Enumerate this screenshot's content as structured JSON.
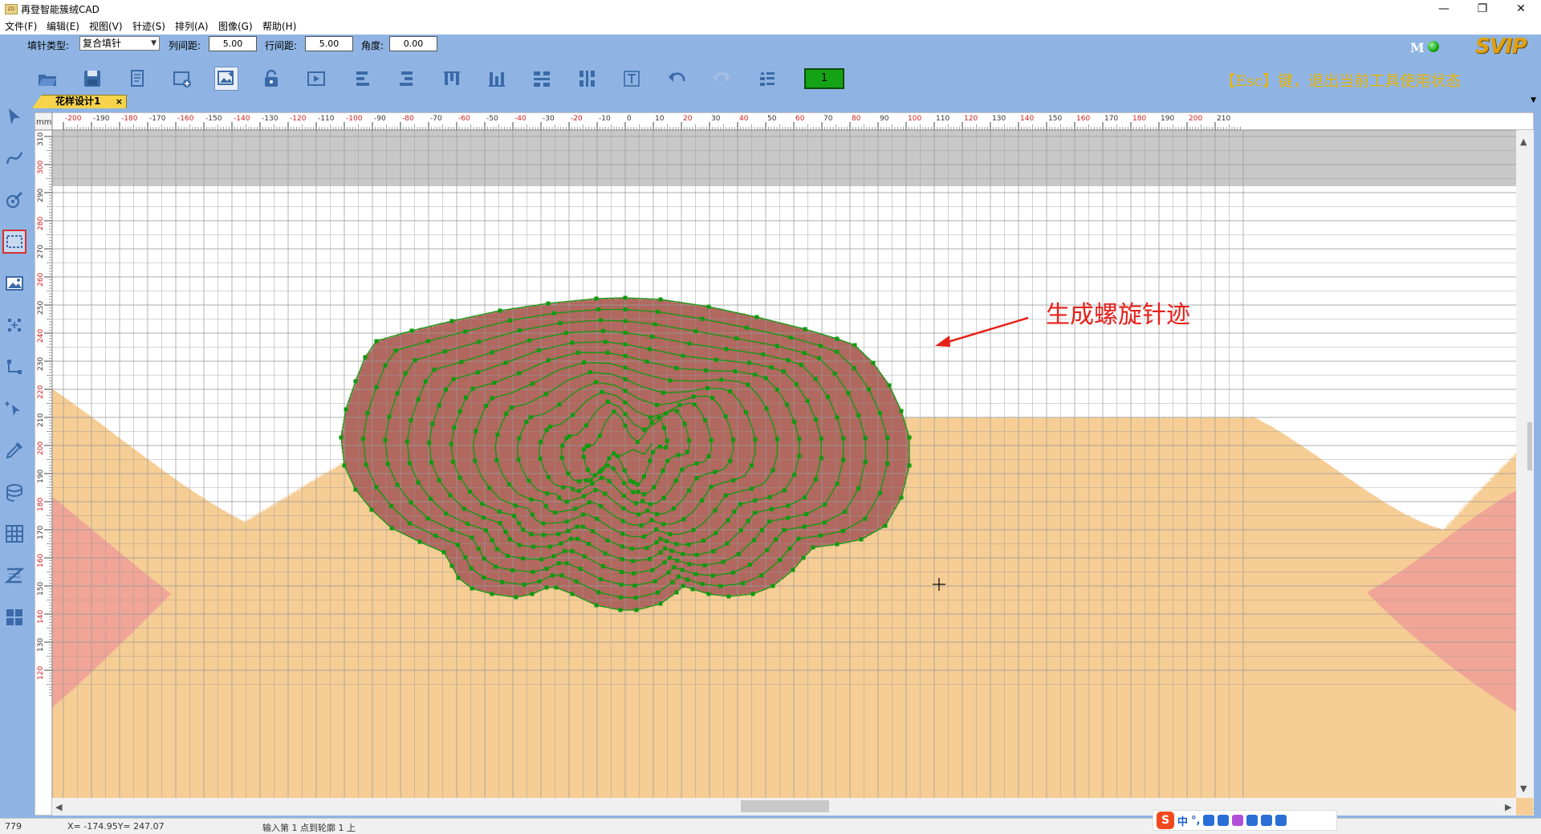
{
  "window": {
    "title": "再登智能簇绒CAD",
    "app_icon_text": "ZD",
    "minimize": "—",
    "restore": "❐",
    "close": "✕"
  },
  "menu": [
    {
      "label": "文件(F)"
    },
    {
      "label": "编辑(E)"
    },
    {
      "label": "视图(V)"
    },
    {
      "label": "针迹(S)"
    },
    {
      "label": "排列(A)"
    },
    {
      "label": "图像(G)"
    },
    {
      "label": "帮助(H)"
    }
  ],
  "params": {
    "fill_type_label": "填针类型:",
    "fill_type_value": "复合填针",
    "col_spacing_label": "列间距:",
    "col_spacing_value": "5.00",
    "row_spacing_label": "行间距:",
    "row_spacing_value": "5.00",
    "angle_label": "角度:",
    "angle_value": "0.00"
  },
  "status_indicators": {
    "m_badge": "M",
    "vip_badge": "SVIP"
  },
  "toolbar": {
    "counter_value": "1",
    "esc_hint": "【Esc】键，退出当前工具使用状态",
    "icons": [
      "open-folder-icon",
      "save-icon",
      "document-icon",
      "new-window-icon",
      "image-edit-icon",
      "unlock-icon",
      "play-icon",
      "align-left-icon",
      "align-right-icon",
      "align-top-icon",
      "align-bottom-icon",
      "distribute-h-icon",
      "distribute-v-icon",
      "text-icon",
      "undo-icon",
      "redo-icon",
      "list-order-icon"
    ]
  },
  "tabs": [
    {
      "label": "花样设计1",
      "close": "×"
    }
  ],
  "left_tools": [
    "select-arrow-icon",
    "curve-icon",
    "pen-tool-icon",
    "rect-select-icon",
    "image-icon",
    "node-edit-icon",
    "connect-icon",
    "cursor-plus-icon",
    "eyedropper-icon",
    "layer-icon",
    "grid-icon",
    "zigzag-icon",
    "tiles-icon"
  ],
  "canvas": {
    "ruler_unit": "mm",
    "x_ticks": [
      -200,
      -190,
      -180,
      -170,
      -160,
      -150,
      -140,
      -130,
      -120,
      -110,
      -100,
      -90,
      -80,
      -70,
      -60,
      -50,
      -40,
      -30,
      -20,
      -10,
      0,
      10,
      20,
      30,
      40,
      50,
      60,
      70,
      80,
      90,
      100,
      110,
      120,
      130,
      140,
      150,
      160,
      170,
      180,
      190,
      200,
      210
    ],
    "y_ticks": [
      310,
      300,
      290,
      280,
      270,
      260,
      250,
      240,
      230,
      220,
      210,
      200,
      190,
      180,
      170,
      160,
      150,
      140,
      130,
      120
    ],
    "annotation": "生成螺旋针迹",
    "colors": {
      "accent_red": "#e6201a",
      "stitch_green": "#0f9a0f",
      "fill_brown": "#b0685e",
      "skin": "#f6cd94",
      "pink": "#ee9e98",
      "grid": "#9a9a9a",
      "gray_band": "#c8c8c8"
    }
  },
  "status": {
    "count": "779",
    "coords": "X= -174.95Y= 247.07",
    "message": "输入第 1 点到轮廓 1 上"
  },
  "ime": {
    "logo": "S",
    "lang": "中",
    "punct": "°,"
  }
}
